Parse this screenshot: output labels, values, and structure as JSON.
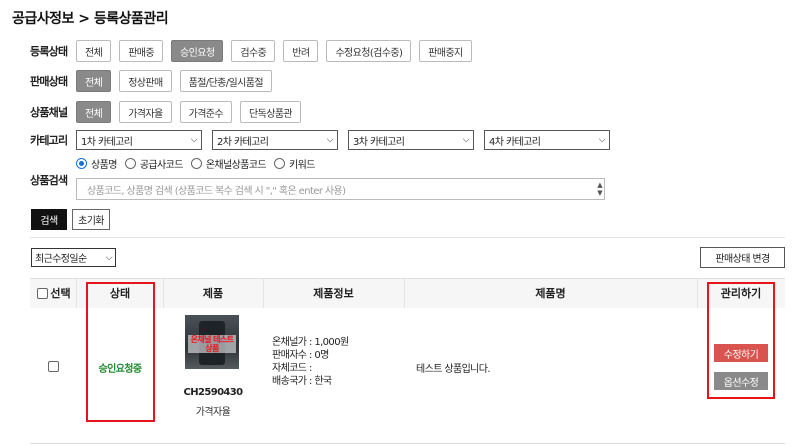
{
  "breadcrumb": "공급사정보 > 등록상품관리",
  "filters": {
    "reg_status": {
      "label": "등록상태",
      "options": [
        "전체",
        "판매중",
        "승인요청",
        "검수중",
        "반려",
        "수정요청(검수중)",
        "판매중지"
      ],
      "active": "승인요청"
    },
    "sale_status": {
      "label": "판매상태",
      "options": [
        "전체",
        "정상판매",
        "품절/단종/일시품절"
      ],
      "active": "전체"
    },
    "channel": {
      "label": "상품채널",
      "options": [
        "전체",
        "가격자율",
        "가격준수",
        "단독상품관"
      ],
      "active": "전체"
    },
    "category": {
      "label": "카테고리",
      "selects": [
        "1차 카테고리",
        "2차 카테고리",
        "3차 카테고리",
        "4차 카테고리"
      ]
    },
    "search": {
      "label": "상품검색",
      "radios": [
        "상품명",
        "공급사코드",
        "온채널상품코드",
        "키워드"
      ],
      "selected_radio": "상품명",
      "placeholder": "상품코드, 상품명 검색 (상품코드 복수 검색 시 \",\" 혹은 enter 사용)"
    }
  },
  "buttons": {
    "search": "검색",
    "reset": "초기화",
    "status_change": "판매상태 변경"
  },
  "sort": {
    "value": "최근수정일순"
  },
  "table": {
    "headers": [
      "선택",
      "상태",
      "제품",
      "제품정보",
      "제품명",
      "관리하기"
    ],
    "rows": [
      {
        "status": "승인요청중",
        "thumb_label": "온채널 테스트상품",
        "code": "CH2590430",
        "channel": "가격자율",
        "info": [
          "온채널가 : 1,000원",
          "판매자수 : 0명",
          "자체코드 :",
          "배송국가 : 한국"
        ],
        "name": "테스트 상품입니다.",
        "actions": [
          "수정하기",
          "옵션수정"
        ]
      }
    ]
  },
  "colors": {
    "status_green": "#1f8a2e",
    "highlight_red": "#e8141b",
    "edit_btn": "#d9534f",
    "option_btn": "#8a8a8a"
  }
}
